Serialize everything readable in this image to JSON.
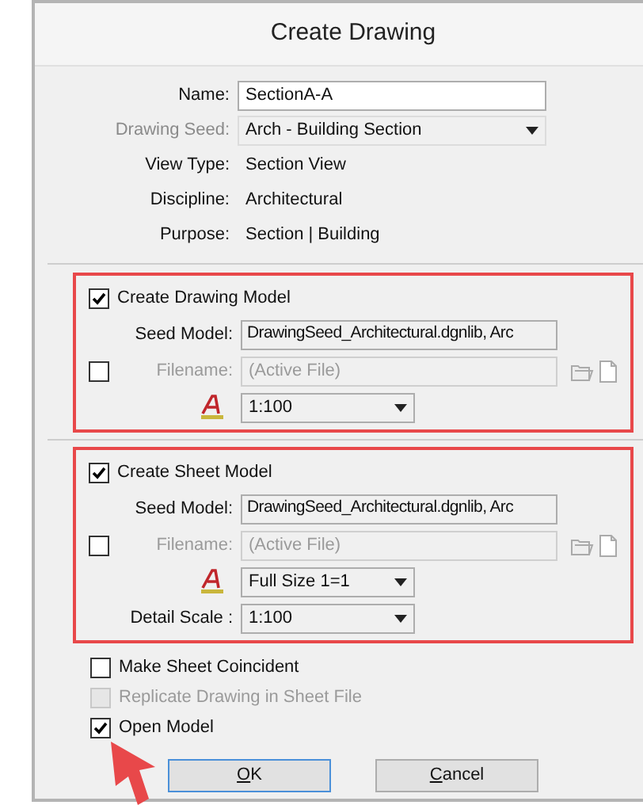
{
  "window": {
    "title": "Create Drawing"
  },
  "fields": [
    {
      "label": "Name:",
      "value": "SectionA-A",
      "kind": "text",
      "disabled": false
    },
    {
      "label": "Drawing Seed:",
      "value": "Arch - Building Section",
      "kind": "dropdown",
      "disabled": true
    },
    {
      "label": "View Type:",
      "value": "Section View",
      "kind": "static",
      "disabled": false
    },
    {
      "label": "Discipline:",
      "value": "Architectural",
      "kind": "static",
      "disabled": false
    },
    {
      "label": "Purpose:",
      "value": "Section | Building",
      "kind": "static",
      "disabled": false
    }
  ],
  "drawing_model": {
    "highlighted": true,
    "checkbox": {
      "label": "Create Drawing Model",
      "checked": true
    },
    "seed_model": {
      "label": "Seed Model:",
      "value": "DrawingSeed_Architectural.dgnlib, Arc"
    },
    "filename": {
      "label": "Filename:",
      "value": "(Active File)",
      "checked": false,
      "disabled": true
    },
    "annotation_scale": {
      "value": "1:100"
    }
  },
  "sheet_model": {
    "highlighted": true,
    "checkbox": {
      "label": "Create Sheet Model",
      "checked": true
    },
    "seed_model": {
      "label": "Seed Model:",
      "value": "DrawingSeed_Architectural.dgnlib, Arc"
    },
    "filename": {
      "label": "Filename:",
      "value": "(Active File)",
      "checked": false,
      "disabled": true
    },
    "annotation_scale": {
      "value": "Full Size 1=1"
    },
    "detail_scale": {
      "label": "Detail Scale :",
      "value": "1:100"
    }
  },
  "options": [
    {
      "label": "Make Sheet Coincident",
      "checked": false,
      "disabled": false
    },
    {
      "label": "Replicate Drawing in Sheet File",
      "checked": false,
      "disabled": true
    },
    {
      "label": "Open Model",
      "checked": true,
      "disabled": false
    }
  ],
  "buttons": [
    {
      "label": "OK",
      "default": true
    },
    {
      "label": "Cancel",
      "default": false
    }
  ],
  "pointer_arrow": true
}
